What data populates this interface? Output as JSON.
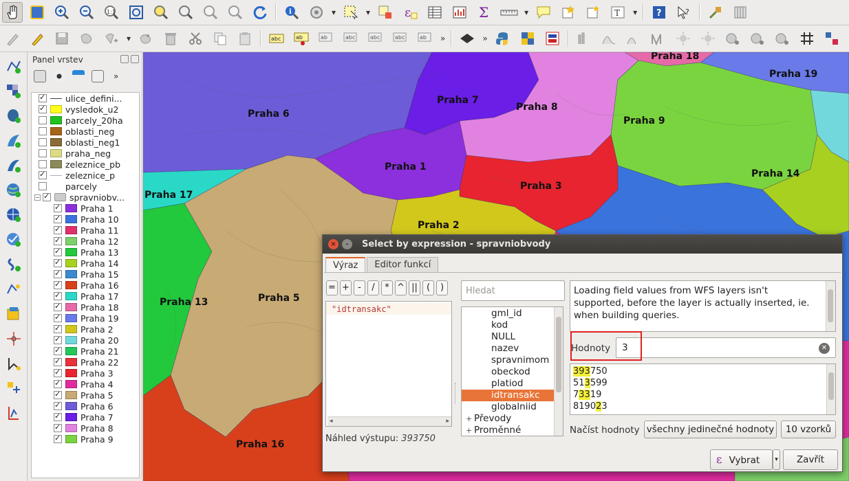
{
  "layers_panel": {
    "title": "Panel vrstev",
    "layers": [
      {
        "name": "ulice_defini...",
        "checked": true,
        "color": "#444444",
        "kind": "line"
      },
      {
        "name": "vysledok_u2",
        "checked": true,
        "color": "#ffff1a",
        "kind": "fill"
      },
      {
        "name": "parcely_20ha",
        "checked": false,
        "color": "#1fc21f",
        "kind": "fill"
      },
      {
        "name": "oblasti_neg",
        "checked": false,
        "color": "#a86418",
        "kind": "fill"
      },
      {
        "name": "oblasti_neg1",
        "checked": false,
        "color": "#8a6a36",
        "kind": "fill"
      },
      {
        "name": "praha_neg",
        "checked": false,
        "color": "#dcdc86",
        "kind": "fill"
      },
      {
        "name": "zeleznice_pb",
        "checked": false,
        "color": "#8b8a5a",
        "kind": "fill"
      },
      {
        "name": "zeleznice_p",
        "checked": true,
        "color": "#aaaaaa",
        "kind": "line"
      },
      {
        "name": "parcely",
        "checked": false,
        "color": "",
        "kind": "none"
      }
    ],
    "group": {
      "name": "spravniobv...",
      "checked": true
    },
    "categories": [
      {
        "name": "Praha 1",
        "color": "#8c2fdc"
      },
      {
        "name": "Praha 10",
        "color": "#3a73dc"
      },
      {
        "name": "Praha 11",
        "color": "#e0306a"
      },
      {
        "name": "Praha 12",
        "color": "#7ed06a"
      },
      {
        "name": "Praha 13",
        "color": "#22c93c"
      },
      {
        "name": "Praha 14",
        "color": "#a8d020"
      },
      {
        "name": "Praha 15",
        "color": "#3c8ad0"
      },
      {
        "name": "Praha 16",
        "color": "#d8401c"
      },
      {
        "name": "Praha 17",
        "color": "#2ad8c8"
      },
      {
        "name": "Praha 18",
        "color": "#e66aa8"
      },
      {
        "name": "Praha 19",
        "color": "#6a7ae8"
      },
      {
        "name": "Praha 2",
        "color": "#d2c81c"
      },
      {
        "name": "Praha 20",
        "color": "#72d8dc"
      },
      {
        "name": "Praha 21",
        "color": "#24c858"
      },
      {
        "name": "Praha 22",
        "color": "#e8323a"
      },
      {
        "name": "Praha 3",
        "color": "#e82430"
      },
      {
        "name": "Praha 4",
        "color": "#e02ca0"
      },
      {
        "name": "Praha 5",
        "color": "#c8aa74"
      },
      {
        "name": "Praha 6",
        "color": "#6d5cd8"
      },
      {
        "name": "Praha 7",
        "color": "#6a1ee6"
      },
      {
        "name": "Praha 8",
        "color": "#e282e0"
      },
      {
        "name": "Praha 9",
        "color": "#7ad440"
      }
    ]
  },
  "map": {
    "labels": [
      "Praha 18",
      "Praha 19",
      "Praha 7",
      "Praha 8",
      "Praha 6",
      "Praha 9",
      "Praha 1",
      "Praha 14",
      "Praha 3",
      "Praha 17",
      "Praha 2",
      "Praha 13",
      "Praha 5",
      "Praha 16"
    ]
  },
  "dialog": {
    "title": "Select by expression - spravniobvody",
    "tabs": [
      "Výraz",
      "Editor funkcí"
    ],
    "operators": [
      "=",
      "+",
      "-",
      "/",
      "*",
      "^",
      "||",
      "(",
      ")"
    ],
    "expression": "\"idtransakc\"",
    "preview_label": "Náhled výstupu:",
    "preview_value": "393750",
    "search_placeholder": "Hledat",
    "fields": [
      "gml_id",
      "kod",
      "NULL",
      "nazev",
      "spravnimom",
      "obeckod",
      "platiod",
      "idtransakc",
      "globalniid"
    ],
    "selected_field": "idtransakc",
    "groups": [
      "Převody",
      "Proměnné"
    ],
    "info_text": "Loading field values from WFS layers isn't supported, before the layer is actually inserted, ie. when building queries.",
    "values_label": "Hodnoty",
    "values_input": "3",
    "values_list": [
      {
        "pre": "",
        "hl": "393",
        "post": "750"
      },
      {
        "pre": "51",
        "hl": "3",
        "post": "599"
      },
      {
        "pre": "7",
        "hl": "33",
        "post": "19"
      },
      {
        "pre": "8190",
        "hl": "2",
        "post": "3"
      }
    ],
    "load_label": "Načíst hodnoty",
    "btn_all_unique": "všechny jedinečné hodnoty",
    "btn_samples": "10 vzorků",
    "btn_select": "Vybrat",
    "btn_close": "Zavřít"
  }
}
